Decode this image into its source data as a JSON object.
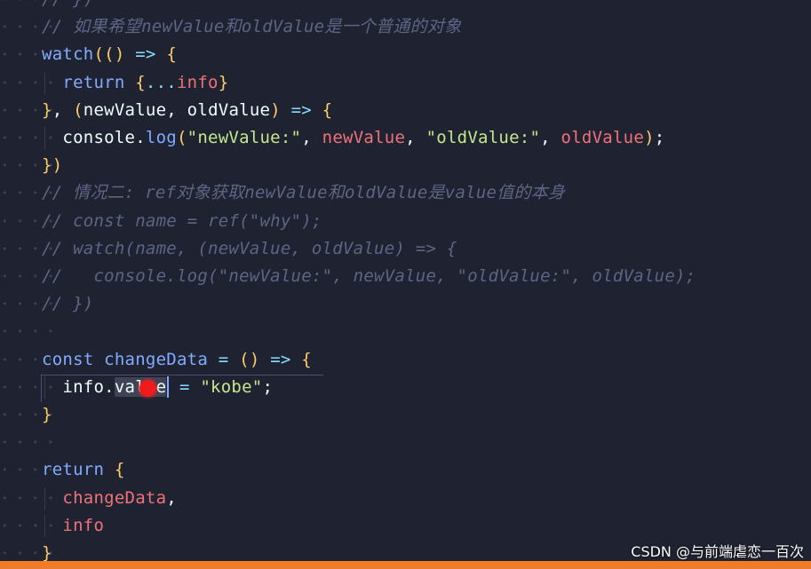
{
  "editor": {
    "lines": [
      {
        "segments": [
          {
            "c": "c",
            "t": "// })"
          }
        ]
      },
      {
        "segments": [
          {
            "c": "c",
            "t": "// 如果希望newValue和oldValue是一个普通的对象"
          }
        ]
      },
      {
        "segments": [
          {
            "c": "f",
            "t": "watch"
          },
          {
            "c": "p",
            "t": "(("
          },
          {
            "c": "p",
            "t": ")"
          },
          {
            "c": "o",
            "t": " => "
          },
          {
            "c": "p",
            "t": "{"
          }
        ]
      },
      {
        "segments": [
          {
            "c": "k",
            "t": "  return "
          },
          {
            "c": "p",
            "t": "{"
          },
          {
            "c": "o",
            "t": "..."
          },
          {
            "c": "r",
            "t": "info"
          },
          {
            "c": "p",
            "t": "}"
          }
        ]
      },
      {
        "segments": [
          {
            "c": "p",
            "t": "}"
          },
          {
            "c": "t",
            "t": ", "
          },
          {
            "c": "p",
            "t": "("
          },
          {
            "c": "t",
            "t": "newValue, oldValue"
          },
          {
            "c": "p",
            "t": ")"
          },
          {
            "c": "o",
            "t": " => "
          },
          {
            "c": "p",
            "t": "{"
          }
        ]
      },
      {
        "segments": [
          {
            "c": "t",
            "t": "  console."
          },
          {
            "c": "f",
            "t": "log"
          },
          {
            "c": "p",
            "t": "("
          },
          {
            "c": "s",
            "t": "\"newValue:\""
          },
          {
            "c": "t",
            "t": ", "
          },
          {
            "c": "r",
            "t": "newValue"
          },
          {
            "c": "t",
            "t": ", "
          },
          {
            "c": "s",
            "t": "\"oldValue:\""
          },
          {
            "c": "t",
            "t": ", "
          },
          {
            "c": "r",
            "t": "oldValue"
          },
          {
            "c": "p",
            "t": ")"
          },
          {
            "c": "t",
            "t": ";"
          }
        ]
      },
      {
        "segments": [
          {
            "c": "p",
            "t": "})"
          }
        ]
      },
      {
        "segments": [
          {
            "c": "c",
            "t": "// 情况二: ref对象获取newValue和oldValue是value值的本身"
          }
        ]
      },
      {
        "segments": [
          {
            "c": "c",
            "t": "// const name = ref(\"why\");"
          }
        ]
      },
      {
        "segments": [
          {
            "c": "c",
            "t": "// watch(name, (newValue, oldValue) => {"
          }
        ]
      },
      {
        "segments": [
          {
            "c": "c",
            "t": "//   console.log(\"newValue:\", newValue, \"oldValue:\", oldValue);"
          }
        ]
      },
      {
        "segments": [
          {
            "c": "c",
            "t": "// })"
          }
        ]
      },
      {
        "segments": []
      },
      {
        "segments": [
          {
            "c": "k",
            "t": "const "
          },
          {
            "c": "f",
            "t": "changeData"
          },
          {
            "c": "o",
            "t": " = "
          },
          {
            "c": "p",
            "t": "("
          },
          {
            "c": "p",
            "t": ")"
          },
          {
            "c": "o",
            "t": " => "
          },
          {
            "c": "p",
            "t": "{"
          }
        ]
      },
      {
        "segments": [
          {
            "c": "t",
            "t": "  info."
          },
          {
            "c": "t sel",
            "t": "value"
          },
          {
            "c": "cursor",
            "t": ""
          },
          {
            "c": "o",
            "t": " = "
          },
          {
            "c": "s",
            "t": "\"kobe\""
          },
          {
            "c": "t",
            "t": ";"
          }
        ]
      },
      {
        "segments": [
          {
            "c": "p",
            "t": "}"
          }
        ]
      },
      {
        "segments": []
      },
      {
        "segments": [
          {
            "c": "k",
            "t": "return "
          },
          {
            "c": "p",
            "t": "{"
          }
        ]
      },
      {
        "segments": [
          {
            "c": "r",
            "t": "  changeData"
          },
          {
            "c": "t",
            "t": ","
          }
        ]
      },
      {
        "segments": [
          {
            "c": "r",
            "t": "  info"
          }
        ]
      },
      {
        "segments": [
          {
            "c": "p",
            "t": "}"
          }
        ]
      }
    ],
    "guide_lines": [
      3,
      5,
      14,
      18,
      19
    ]
  },
  "watermark": "CSDN @与前端虐恋一百次",
  "colors": {
    "background": "#1f2331",
    "keyword": "#82aaff",
    "string": "#c3e88d",
    "variable": "#f07178",
    "comment": "#5c6584",
    "bracket": "#ffcb6b",
    "accent_bar": "#f07c2a"
  }
}
